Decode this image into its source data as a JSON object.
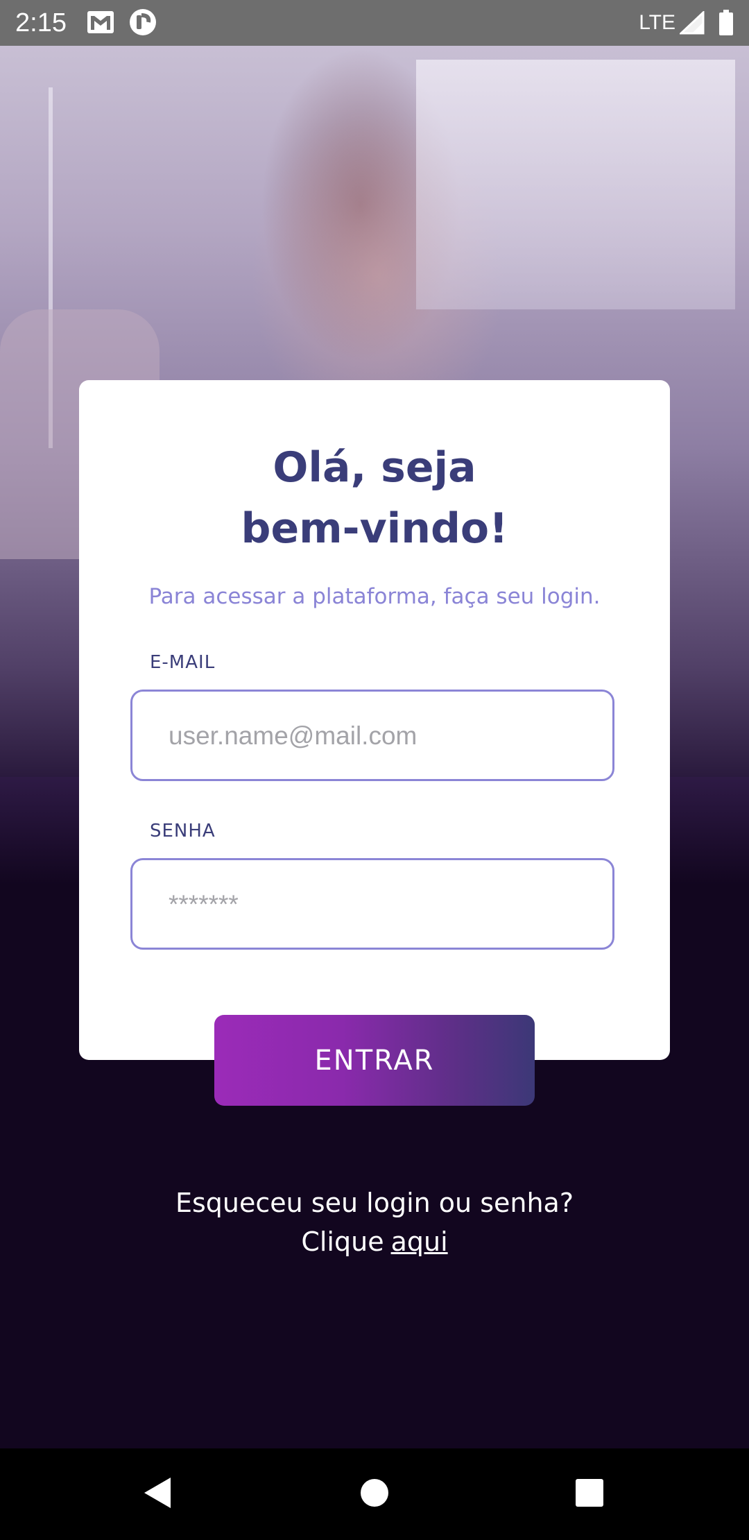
{
  "status_bar": {
    "time": "2:15",
    "network": "LTE",
    "icons": [
      "gmail-icon",
      "app-notification-icon",
      "signal-icon",
      "battery-icon"
    ]
  },
  "card": {
    "title_line1": "Olá, seja",
    "title_line2": "bem-vindo!",
    "subtitle": "Para acessar a plataforma, faça seu login."
  },
  "form": {
    "email_label": "E-MAIL",
    "email_placeholder": "user.name@mail.com",
    "email_value": "",
    "password_label": "SENHA",
    "password_placeholder": "*******",
    "password_value": "",
    "submit_label": "ENTRAR"
  },
  "forgot": {
    "question": "Esqueceu seu login ou senha?",
    "prefix": "Clique",
    "link_label": "aqui"
  },
  "colors": {
    "title": "#3a3d79",
    "subtitle": "#8a84d6",
    "field_border": "#8b85d6",
    "background": "#12061f",
    "button_start": "#9b2bb8",
    "button_end": "#3c3877"
  },
  "nav_bar": {
    "icons": [
      "back-icon",
      "home-icon",
      "recents-icon"
    ]
  }
}
